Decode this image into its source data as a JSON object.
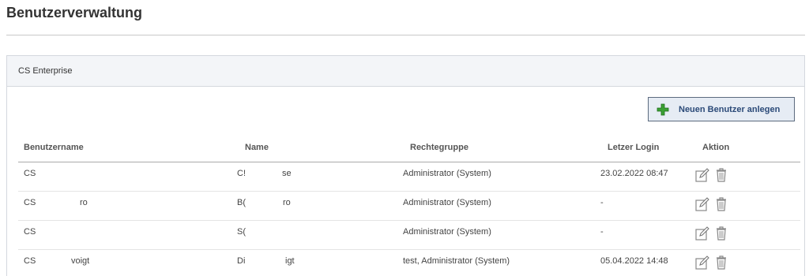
{
  "page": {
    "title": "Benutzerverwaltung"
  },
  "panel": {
    "title": "CS Enterprise"
  },
  "toolbar": {
    "add_user_label": "Neuen Benutzer anlegen"
  },
  "table": {
    "headers": [
      "Benutzername",
      "Name",
      "Rechtegruppe",
      "Letzer Login",
      "Aktion"
    ],
    "rows": [
      {
        "user": "CS",
        "user_tail": "",
        "name": "C!",
        "name_tail": "se",
        "group": "Administrator (System)",
        "login": "23.02.2022 08:47"
      },
      {
        "user": "CS",
        "user_tail": "ro",
        "name": "B(",
        "name_tail": "ro",
        "group": "Administrator (System)",
        "login": "-"
      },
      {
        "user": "CS",
        "user_tail": "",
        "name": "S(",
        "name_tail": "",
        "group": "Administrator (System)",
        "login": "-"
      },
      {
        "user": "CS",
        "user_tail": "voigt",
        "name": "Di",
        "name_tail": "igt",
        "group": "test, Administrator (System)",
        "login": "05.04.2022 14:48"
      }
    ]
  },
  "icons": {
    "add": "plus-icon",
    "edit": "edit-icon",
    "delete": "trash-icon"
  },
  "colors": {
    "button_bg": "#e6ecf4",
    "button_border": "#5c6b7f",
    "button_text": "#2b4a78",
    "plus_green": "#3aa033"
  }
}
